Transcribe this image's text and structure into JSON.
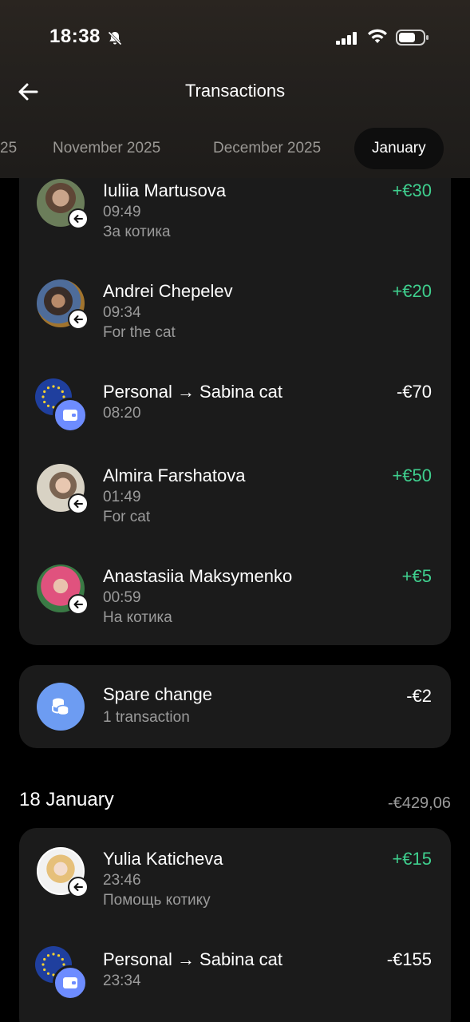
{
  "status_bar": {
    "time": "18:38"
  },
  "header": {
    "title": "Transactions"
  },
  "months": [
    {
      "label": "25"
    },
    {
      "label": "November 2025"
    },
    {
      "label": "December 2025"
    },
    {
      "label": "January"
    }
  ],
  "group1": {
    "transactions": [
      {
        "name": "Iuliia Martusova",
        "time": "09:49",
        "note": "За котика",
        "amount": "+€30"
      },
      {
        "name": "Andrei Chepelev",
        "time": "09:34",
        "note": "For the cat",
        "amount": "+€20"
      },
      {
        "name": "Personal → Sabina cat",
        "time": "08:20",
        "note": "",
        "amount": "-€70"
      },
      {
        "name": "Almira Farshatova",
        "time": "01:49",
        "note": "For cat",
        "amount": "+€50"
      },
      {
        "name": "Anastasiia Maksymenko",
        "time": "00:59",
        "note": "На котика",
        "amount": "+€5"
      }
    ]
  },
  "spare_change": {
    "label": "Spare change",
    "count": "1 transaction",
    "amount": "-€2"
  },
  "group2": {
    "date": "18 January",
    "total": "-€429,06",
    "transactions": [
      {
        "name": "Yulia Katicheva",
        "time": "23:46",
        "note": "Помощь котику",
        "amount": "+€15"
      },
      {
        "name": "Personal → Sabina cat",
        "time": "23:34",
        "note": "",
        "amount": "-€155"
      }
    ]
  },
  "colors": {
    "positive": "#3fcf8e",
    "accent": "#6d8cff",
    "card": "#1b1b1b"
  }
}
